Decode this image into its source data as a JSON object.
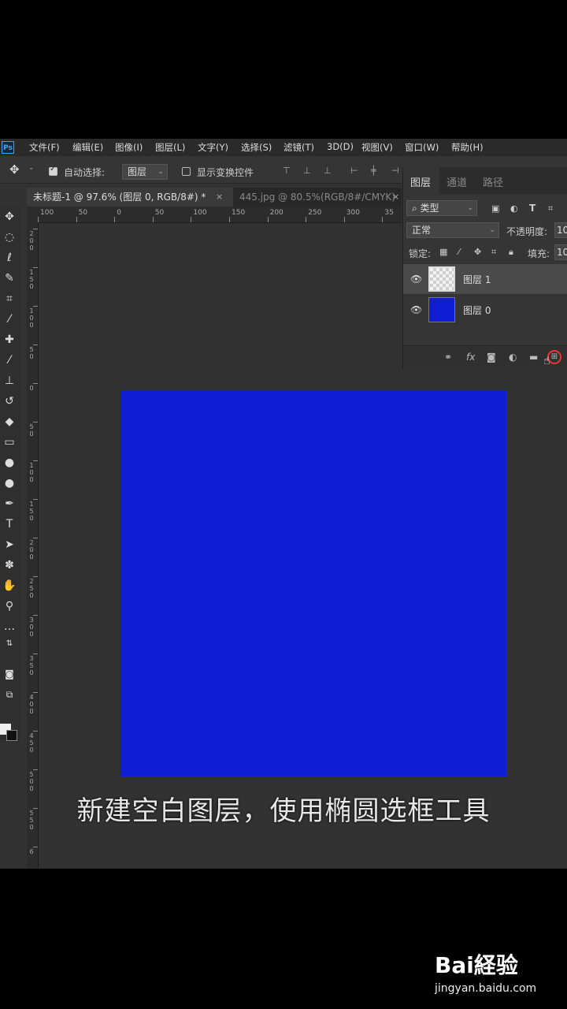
{
  "menu": {
    "app_icon": "Ps",
    "items": [
      "文件(F)",
      "编辑(E)",
      "图像(I)",
      "图层(L)",
      "文字(Y)",
      "选择(S)",
      "滤镜(T)",
      "3D(D)",
      "视图(V)",
      "窗口(W)",
      "帮助(H)"
    ]
  },
  "options": {
    "auto_select_label": "自动选择:",
    "auto_select_value": "图层",
    "show_transform_label": "显示变换控件"
  },
  "tabs": [
    {
      "label": "未标题-1 @ 97.6% (图层 0, RGB/8#) *",
      "close": "×"
    },
    {
      "label": "445.jpg @ 80.5%(RGB/8#/CMYK)",
      "close": "×"
    }
  ],
  "ruler": {
    "h_labels": [
      "100",
      "50",
      "0",
      "50",
      "100",
      "150",
      "200",
      "250",
      "300",
      "35"
    ],
    "v_labels": [
      "200",
      "150",
      "100",
      "50",
      "0",
      "50",
      "100",
      "150",
      "200",
      "250",
      "300",
      "350",
      "400",
      "450",
      "500",
      "550",
      "6"
    ]
  },
  "layers_panel": {
    "tabs": [
      "图层",
      "通道",
      "路径"
    ],
    "filter_kind": "类型",
    "blend_mode": "正常",
    "opacity_label": "不透明度:",
    "opacity_value": "10",
    "lock_label": "锁定:",
    "fill_label": "填充:",
    "fill_value": "10",
    "layers": [
      {
        "name": "图层 1",
        "thumb": "transparent",
        "selected": true
      },
      {
        "name": "图层 0",
        "thumb": "blue",
        "selected": false
      }
    ],
    "bottom_fx": "fx"
  },
  "canvas": {
    "fill_color": "#0f1ed3"
  },
  "caption": "新建空白图层，使用椭圆选框工具",
  "watermark": {
    "logo": "Bai経验",
    "url": "jingyan.baidu.com"
  }
}
